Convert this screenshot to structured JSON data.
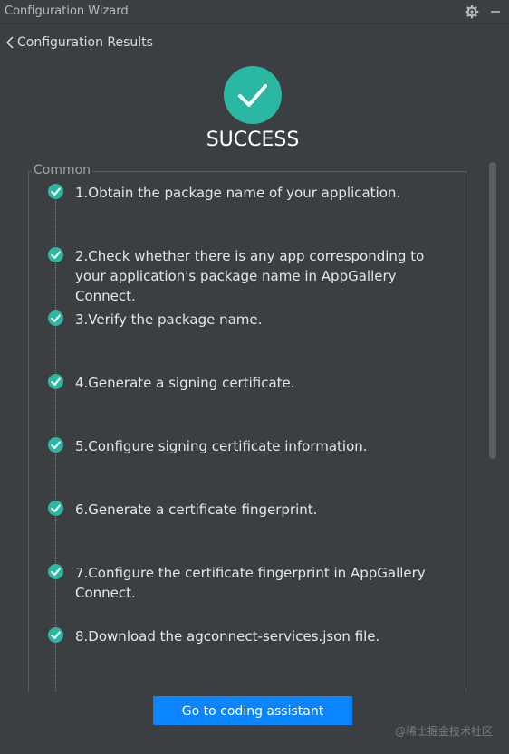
{
  "window": {
    "title": "Configuration Wizard",
    "icons": [
      "gear-icon",
      "minimize-icon"
    ]
  },
  "nav": {
    "back_label": "Configuration Results",
    "back_icon": "chevron-left-icon"
  },
  "status": {
    "icon": "check-icon",
    "text": "SUCCESS",
    "color": "#2ab8a2"
  },
  "group": {
    "legend": "Common",
    "steps": [
      {
        "label": "1.Obtain the package name of your application.",
        "done": true
      },
      {
        "label": "2.Check whether there is any app corresponding to your application's package name in AppGallery Connect.",
        "done": true
      },
      {
        "label": "3.Verify the package name.",
        "done": true
      },
      {
        "label": "4.Generate a signing certificate.",
        "done": true
      },
      {
        "label": "5.Configure signing certificate information.",
        "done": true
      },
      {
        "label": "6.Generate a certificate fingerprint.",
        "done": true
      },
      {
        "label": "7.Configure the certificate fingerprint in AppGallery Connect.",
        "done": true
      },
      {
        "label": "8.Download the agconnect-services.json file.",
        "done": true
      }
    ]
  },
  "footer": {
    "button_label": "Go to coding assistant",
    "button_color": "#0a84ff"
  },
  "watermark": "@稀土掘金技术社区",
  "colors": {
    "background": "#3c3f41",
    "check": "#2ab8a2",
    "timeline": "#3aa3a8"
  }
}
